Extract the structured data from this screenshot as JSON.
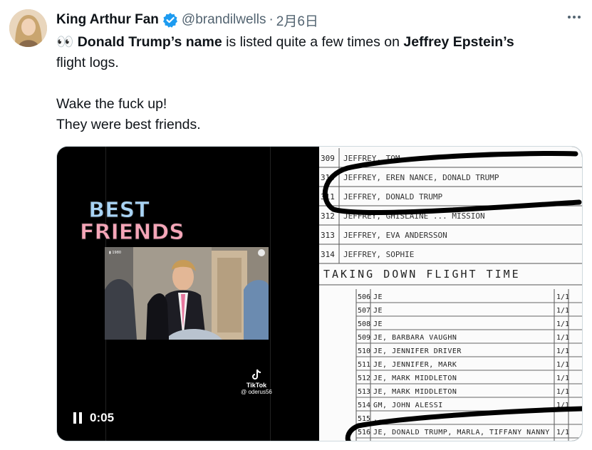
{
  "author": {
    "name": "King Arthur Fan",
    "handle": "@brandilwells",
    "separator": "·",
    "date": "2月6日",
    "verified": true
  },
  "tweet": {
    "line1_emoji": "👀",
    "line1_bold1": "Donald Trump’s name",
    "line1_text": " is listed quite a few times on ",
    "line1_bold2": "Jeffrey Epstein’s",
    "line2": "flight logs.",
    "line3": "Wake the fuck up!",
    "line4": "They were best friends."
  },
  "video": {
    "overlay_title_1": "BEST",
    "overlay_title_2": "FRIENDS",
    "watermark": "TikTok",
    "watermark_handle": "@ oderus56",
    "elapsed": "0:05"
  },
  "more_icon": "more-horizontal-icon",
  "colors": {
    "verified": "#1d9bf0",
    "secondary_text": "#536471",
    "best_friends_top": "#a9d4f5",
    "best_friends_bottom": "#f5a6b8"
  },
  "flight_log": {
    "rows_top": [
      {
        "num": "309",
        "text": "JEFFREY, TOM ..."
      },
      {
        "num": "310",
        "text": "JEFFREY, EREN NANCE, DONALD TRUMP"
      },
      {
        "num": "311",
        "text": "JEFFREY, DONALD TRUMP"
      },
      {
        "num": "312",
        "text": "JEFFREY, GHISLAINE ... MISSION"
      },
      {
        "num": "313",
        "text": "JEFFREY, EVA ANDERSSON"
      },
      {
        "num": "314",
        "text": "JEFFREY, SOPHIE"
      }
    ],
    "heading": "TAKING DOWN FLIGHT TIME",
    "rows_bottom": [
      {
        "num": "506",
        "text": "JE",
        "mark": "1/1"
      },
      {
        "num": "507",
        "text": "JE",
        "mark": "1/1"
      },
      {
        "num": "508",
        "text": "JE",
        "mark": "1/1"
      },
      {
        "num": "509",
        "text": "JE, BARBARA VAUGHN",
        "mark": "1/1"
      },
      {
        "num": "510",
        "text": "JE, JENNIFER DRIVER",
        "mark": "1/1"
      },
      {
        "num": "511",
        "text": "JE, JENNIFER, MARK",
        "mark": "1/1"
      },
      {
        "num": "512",
        "text": "JE, MARK MIDDLETON",
        "mark": "1/1"
      },
      {
        "num": "513",
        "text": "JE, MARK MIDDLETON",
        "mark": "1/1"
      },
      {
        "num": "514",
        "text": "GM, JOHN ALESSI",
        "mark": "1/1"
      },
      {
        "num": "515",
        "text": "...",
        "mark": ""
      },
      {
        "num": "516",
        "text": "JE, DONALD TRUMP, MARLA, TIFFANY NANNY",
        "mark": "1/1"
      }
    ]
  }
}
